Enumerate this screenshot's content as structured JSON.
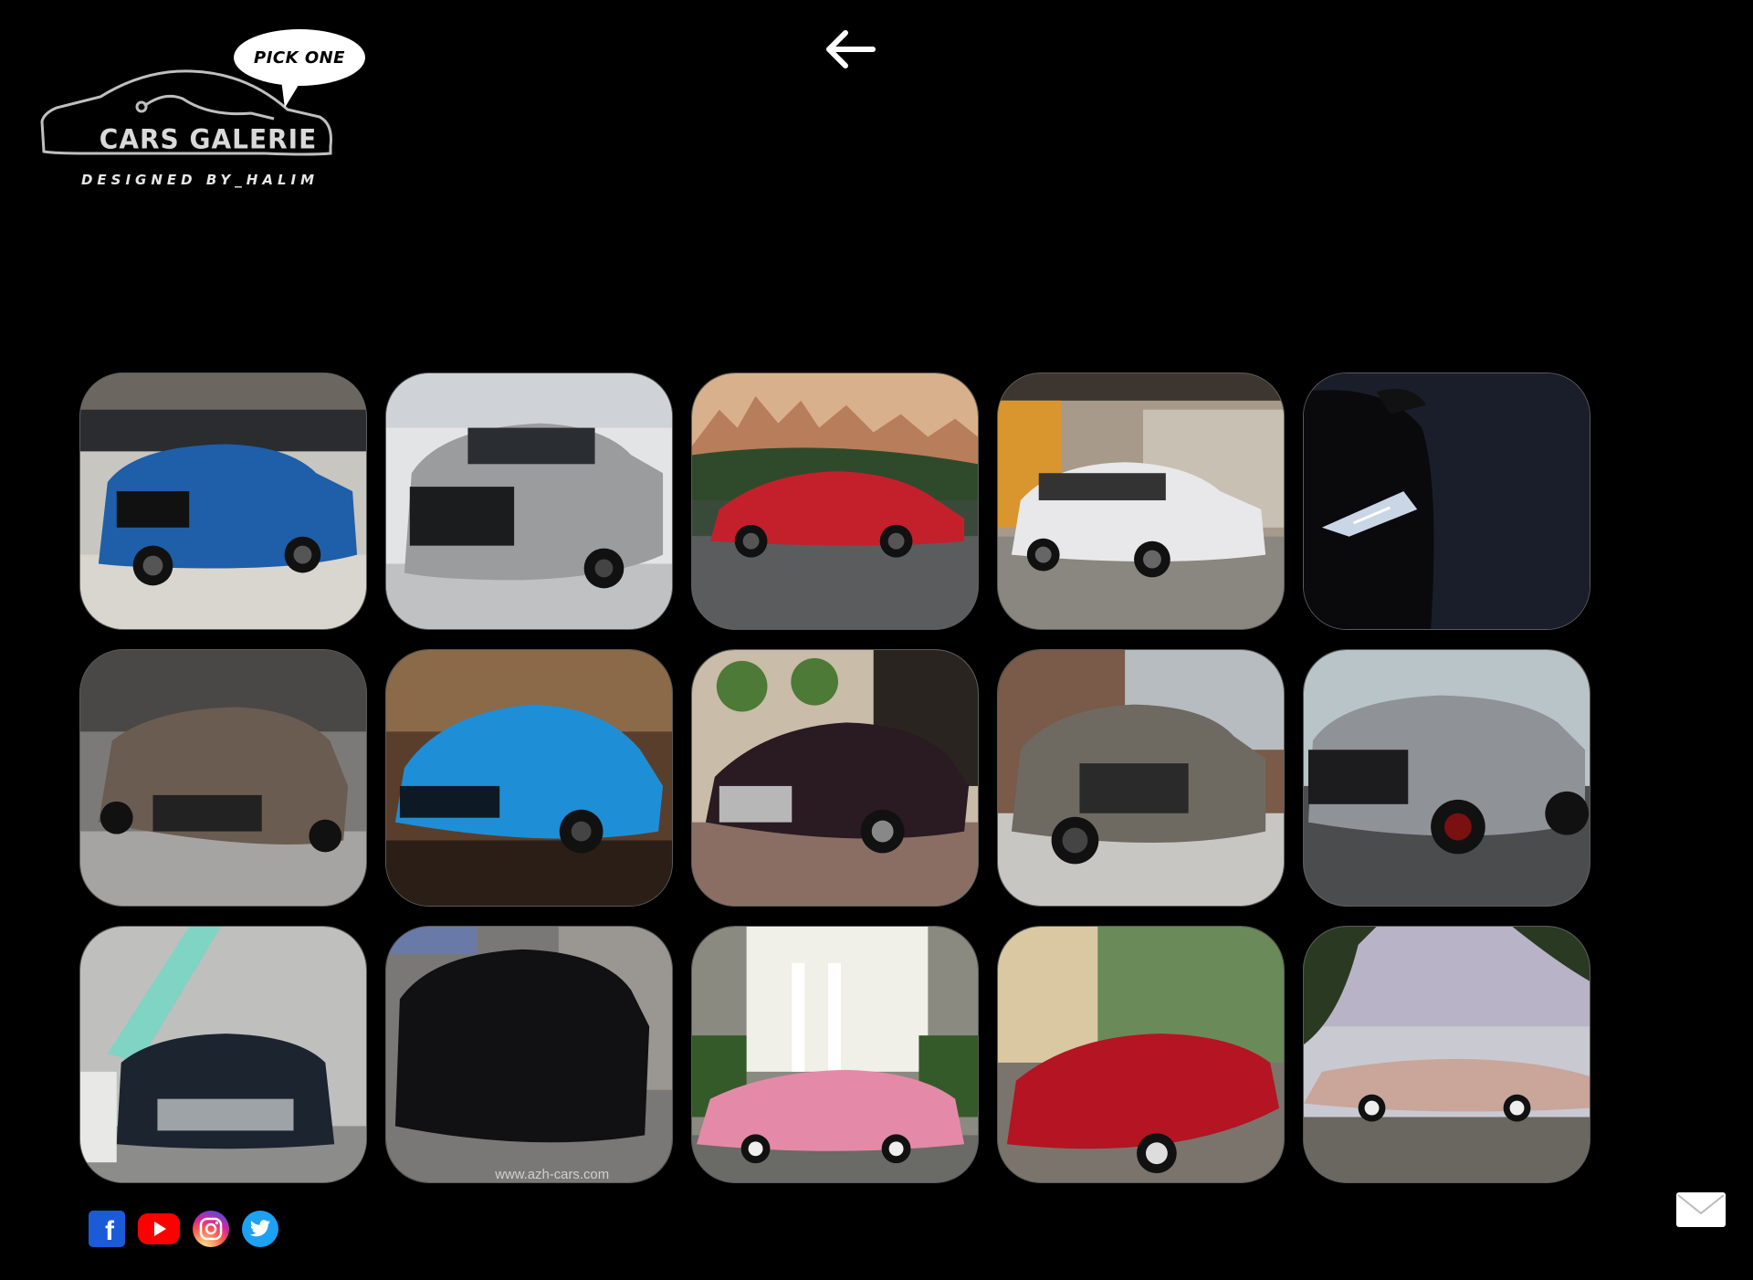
{
  "logo": {
    "bubble_text": "PICK ONE",
    "title": "CARS GALERIE",
    "tagline": "DESIGNED BY_HALIM"
  },
  "nav": {
    "back_icon": "arrow-left-icon"
  },
  "gallery": {
    "cards": [
      {
        "subject": "blue Cadillac Escalade",
        "color": "#1f5ea8"
      },
      {
        "subject": "grey Cadillac Escalade",
        "color": "#9a9c9e"
      },
      {
        "subject": "red Cadillac CT5-V sedan",
        "color": "#c4202c"
      },
      {
        "subject": "white Cadillac XT6",
        "color": "#e8e8ea"
      },
      {
        "subject": "dark Cadillac headlight",
        "color": "#1a1e2a"
      },
      {
        "subject": "bronze Cadillac CTS-V",
        "color": "#6a5c50"
      },
      {
        "subject": "blue Cadillac CT4-V",
        "color": "#1e8fd6"
      },
      {
        "subject": "black Cadillac Ciel convertible",
        "color": "#2a1a22"
      },
      {
        "subject": "grey Cadillac Escalade",
        "color": "#6e6a62"
      },
      {
        "subject": "silver Cadillac Escalade",
        "color": "#8f9296"
      },
      {
        "subject": "black Cadillac CT6",
        "color": "#1c2430"
      },
      {
        "subject": "black Cadillac Escalade",
        "color": "#111114"
      },
      {
        "subject": "pink classic Cadillac",
        "color": "#e48aa8"
      },
      {
        "subject": "red classic Cadillac convertible",
        "color": "#b51422"
      },
      {
        "subject": "pink classic Cadillac",
        "color": "#caa59a"
      }
    ],
    "watermark": "www.azh-cars.com"
  },
  "social": {
    "items": [
      {
        "name": "facebook-icon",
        "glyph": "f"
      },
      {
        "name": "youtube-icon"
      },
      {
        "name": "instagram-icon"
      },
      {
        "name": "twitter-icon"
      }
    ]
  },
  "contact": {
    "icon": "mail-icon"
  }
}
